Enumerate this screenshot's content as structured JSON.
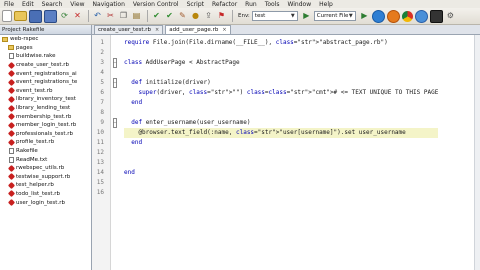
{
  "menu": [
    "File",
    "Edit",
    "Search",
    "View",
    "Navigation",
    "Version Control",
    "Script",
    "Refactor",
    "Run",
    "Tools",
    "Window",
    "Help"
  ],
  "toolbar": {
    "env_label": "Env:",
    "env_value": "test",
    "run_config": "Current File"
  },
  "project_panel": {
    "title": "Project  Rakefile",
    "items": [
      {
        "label": "web-rspec",
        "icon": "folder-icon",
        "indent": 0
      },
      {
        "label": "pages",
        "icon": "folder-icon",
        "indent": 1
      },
      {
        "label": "buildwise.rake",
        "icon": "text-icon",
        "indent": 1
      },
      {
        "label": "create_user_test.rb",
        "icon": "ruby-icon",
        "indent": 1
      },
      {
        "label": "event_registrations_ai",
        "icon": "ruby-icon",
        "indent": 1
      },
      {
        "label": "event_registrations_te",
        "icon": "ruby-icon",
        "indent": 1
      },
      {
        "label": "event_test.rb",
        "icon": "ruby-icon",
        "indent": 1
      },
      {
        "label": "library_inventory_test",
        "icon": "ruby-icon",
        "indent": 1
      },
      {
        "label": "library_lending_test",
        "icon": "ruby-icon",
        "indent": 1
      },
      {
        "label": "membership_test.rb",
        "icon": "ruby-icon",
        "indent": 1
      },
      {
        "label": "member_login_test.rb",
        "icon": "ruby-icon",
        "indent": 1
      },
      {
        "label": "professionals_test.rb",
        "icon": "ruby-icon",
        "indent": 1
      },
      {
        "label": "profile_test.rb",
        "icon": "ruby-icon",
        "indent": 1
      },
      {
        "label": "Rakefile",
        "icon": "text-icon",
        "indent": 1
      },
      {
        "label": "ReadMe.txt",
        "icon": "text-icon",
        "indent": 1
      },
      {
        "label": "rwebspec_utils.rb",
        "icon": "ruby-icon",
        "indent": 1
      },
      {
        "label": "testwise_support.rb",
        "icon": "ruby-icon",
        "indent": 1
      },
      {
        "label": "test_helper.rb",
        "icon": "ruby-icon",
        "indent": 1
      },
      {
        "label": "todo_list_test.rb",
        "icon": "ruby-icon",
        "indent": 1
      },
      {
        "label": "user_login_test.rb",
        "icon": "ruby-icon",
        "indent": 1
      }
    ]
  },
  "tabs": [
    {
      "label": "create_user_test.rb",
      "active": false
    },
    {
      "label": "add_user_page.rb",
      "active": true
    }
  ],
  "editor": {
    "line_numbers": [
      "1",
      "2",
      "3",
      "4",
      "5",
      "6",
      "7",
      "8",
      "9",
      "10",
      "11",
      "12",
      "13",
      "14",
      "15",
      "16"
    ],
    "lines": [
      "require File.join(File.dirname(__FILE__), \"abstract_page.rb\")",
      "",
      "class AddUserPage < AbstractPage",
      "",
      "  def initialize(driver)",
      "    super(driver, \"\") # <= TEXT UNIQUE TO THIS PAGE",
      "  end",
      "",
      "  def enter_username(user_username)",
      "    @browser.text_field(:name, \"user[username]\").set user_username",
      "  end",
      "",
      "",
      "end",
      "",
      ""
    ]
  }
}
